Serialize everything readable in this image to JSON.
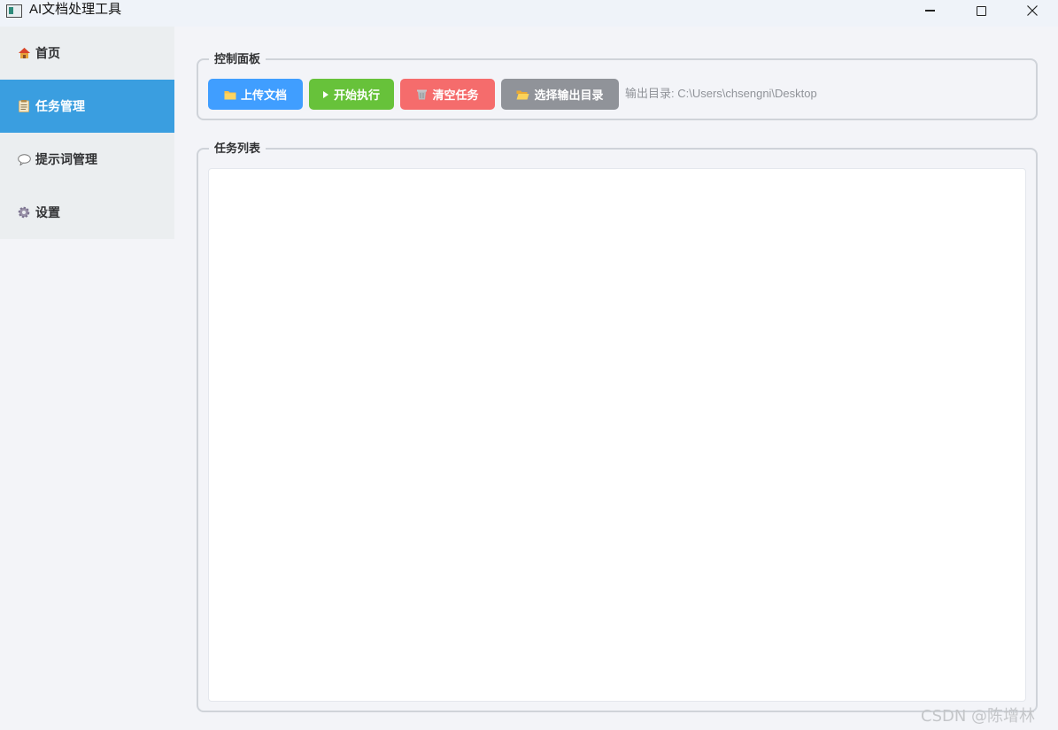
{
  "window": {
    "title": "AI文档处理工具"
  },
  "sidebar": {
    "items": [
      {
        "label": "首页",
        "icon": "house-icon",
        "active": false
      },
      {
        "label": "任务管理",
        "icon": "clipboard-icon",
        "active": true
      },
      {
        "label": "提示词管理",
        "icon": "speech-bubble-icon",
        "active": false
      },
      {
        "label": "设置",
        "icon": "gear-icon",
        "active": false
      }
    ]
  },
  "control_panel": {
    "title": "控制面板",
    "buttons": {
      "upload": "上传文档",
      "start": "开始执行",
      "clear": "清空任务",
      "output": "选择输出目录"
    },
    "output_dir": "输出目录: C:\\Users\\chsengni\\Desktop"
  },
  "task_list": {
    "title": "任务列表"
  },
  "watermark": "CSDN @陈增林",
  "colors": {
    "accent": "#3a9ee0",
    "upload": "#409eff",
    "start": "#67c23a",
    "clear": "#f56c6c",
    "output": "#909399"
  }
}
